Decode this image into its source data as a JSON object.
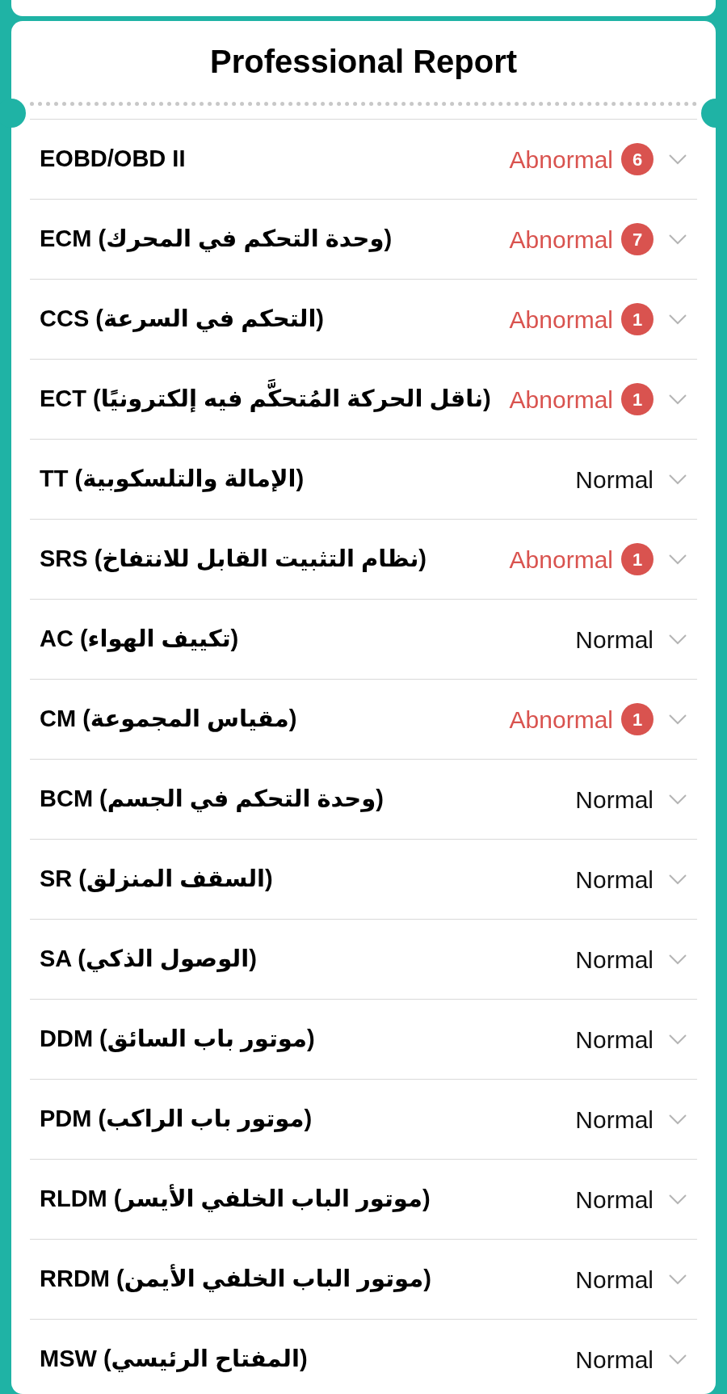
{
  "title": "Professional Report",
  "rows": [
    {
      "label": "EOBD/OBD II",
      "status": "Abnormal",
      "abnormal": true,
      "count": "6"
    },
    {
      "label": "ECM (وحدة التحكم في المحرك)",
      "status": "Abnormal",
      "abnormal": true,
      "count": "7"
    },
    {
      "label": "CCS (التحكم في السرعة)",
      "status": "Abnormal",
      "abnormal": true,
      "count": "1"
    },
    {
      "label": "ECT (ناقل الحركة المُتحكَّم فيه إلكترونيًا)",
      "status": "Abnormal",
      "abnormal": true,
      "count": "1"
    },
    {
      "label": "TT (الإمالة والتلسكوبية)",
      "status": "Normal",
      "abnormal": false
    },
    {
      "label": "SRS (نظام التثبيت القابل للانتفاخ)",
      "status": "Abnormal",
      "abnormal": true,
      "count": "1"
    },
    {
      "label": "AC (تكييف الهواء)",
      "status": "Normal",
      "abnormal": false
    },
    {
      "label": "CM (مقياس المجموعة)",
      "status": "Abnormal",
      "abnormal": true,
      "count": "1"
    },
    {
      "label": "BCM (وحدة التحكم في الجسم)",
      "status": "Normal",
      "abnormal": false
    },
    {
      "label": "SR (السقف المنزلق)",
      "status": "Normal",
      "abnormal": false
    },
    {
      "label": "SA (الوصول الذكي)",
      "status": "Normal",
      "abnormal": false
    },
    {
      "label": "DDM (موتور باب السائق)",
      "status": "Normal",
      "abnormal": false
    },
    {
      "label": "PDM (موتور باب الراكب)",
      "status": "Normal",
      "abnormal": false
    },
    {
      "label": "RLDM (موتور الباب الخلفي الأيسر)",
      "status": "Normal",
      "abnormal": false
    },
    {
      "label": "RRDM (موتور الباب الخلفي الأيمن)",
      "status": "Normal",
      "abnormal": false
    },
    {
      "label": "MSW (المفتاح الرئيسي)",
      "status": "Normal",
      "abnormal": false
    }
  ]
}
